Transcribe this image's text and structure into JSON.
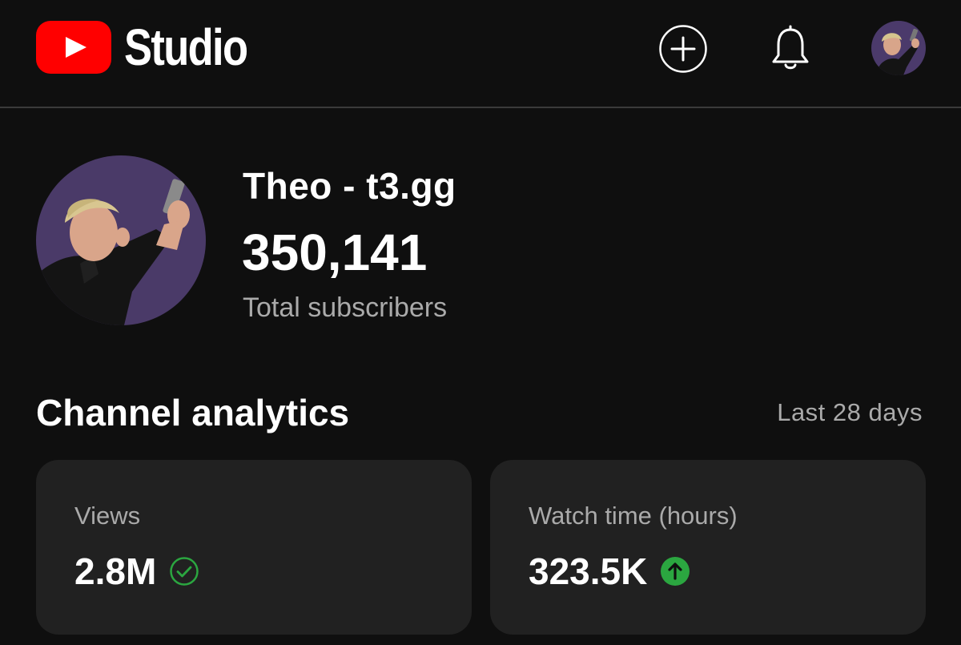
{
  "header": {
    "app_name": "Studio",
    "logo_icon": "youtube-play-icon",
    "actions": [
      {
        "icon": "create-plus-icon"
      },
      {
        "icon": "bell-icon"
      },
      {
        "icon": "account-avatar"
      }
    ]
  },
  "channel": {
    "name": "Theo - t3.gg",
    "subscriber_count": "350,141",
    "subscriber_label": "Total subscribers"
  },
  "analytics": {
    "title": "Channel analytics",
    "period": "Last 28 days",
    "cards": [
      {
        "label": "Views",
        "value": "2.8M",
        "status_icon": "check-circle-icon",
        "status_color": "#2ba640"
      },
      {
        "label": "Watch time (hours)",
        "value": "323.5K",
        "status_icon": "arrow-up-circle-icon",
        "status_color": "#2ba640"
      }
    ]
  },
  "colors": {
    "background": "#0f0f0f",
    "card": "#212121",
    "brand_red": "#ff0000",
    "muted_text": "#aaaaaa"
  }
}
